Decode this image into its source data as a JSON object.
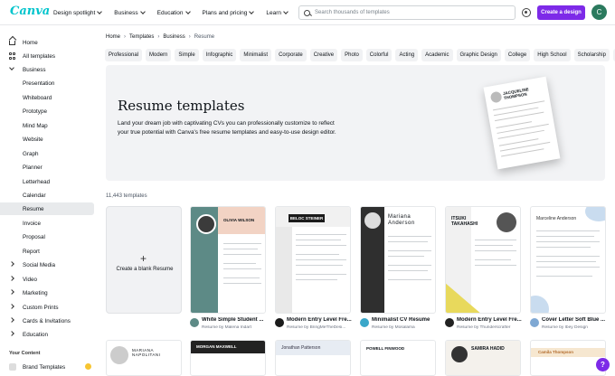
{
  "brand": {
    "logo": "Canva",
    "accent": "#7d2ae8",
    "logo_color": "#00c4cc"
  },
  "topnav": [
    {
      "label": "Design spotlight"
    },
    {
      "label": "Business"
    },
    {
      "label": "Education"
    },
    {
      "label": "Plans and pricing"
    },
    {
      "label": "Learn"
    }
  ],
  "search": {
    "placeholder": "Search thousands of templates"
  },
  "header": {
    "create_label": "Create a design",
    "avatar_initial": "C"
  },
  "sidebar": {
    "items": [
      {
        "label": "Home",
        "icon": "home-icon"
      },
      {
        "label": "All templates",
        "icon": "grid-icon"
      },
      {
        "label": "Business",
        "icon": "chevron-down-icon"
      },
      {
        "label": "Presentation"
      },
      {
        "label": "Whiteboard"
      },
      {
        "label": "Prototype"
      },
      {
        "label": "Mind Map"
      },
      {
        "label": "Website"
      },
      {
        "label": "Graph"
      },
      {
        "label": "Planner"
      },
      {
        "label": "Letterhead"
      },
      {
        "label": "Calendar"
      },
      {
        "label": "Resume"
      },
      {
        "label": "Invoice"
      },
      {
        "label": "Proposal"
      },
      {
        "label": "Report"
      },
      {
        "label": "Social Media",
        "icon": "chevron-right-icon"
      },
      {
        "label": "Video",
        "icon": "chevron-right-icon"
      },
      {
        "label": "Marketing",
        "icon": "chevron-right-icon"
      },
      {
        "label": "Custom Prints",
        "icon": "chevron-right-icon"
      },
      {
        "label": "Cards & Invitations",
        "icon": "chevron-right-icon"
      },
      {
        "label": "Education",
        "icon": "chevron-right-icon"
      }
    ],
    "section_title": "Your Content",
    "bottom_item": "Brand Templates"
  },
  "breadcrumb": [
    "Home",
    "Templates",
    "Business",
    "Resume"
  ],
  "chips": [
    "Professional",
    "Modern",
    "Simple",
    "Infographic",
    "Minimalist",
    "Corporate",
    "Creative",
    "Photo",
    "Colorful",
    "Acting",
    "Academic",
    "Graphic Design",
    "College",
    "High School",
    "Scholarship",
    "SE"
  ],
  "hero": {
    "title": "Resume templates",
    "desc": "Land your dream job with captivating CVs you can professionally customize to reflect your true potential with Canva's free resume templates and easy-to-use design editor.",
    "preview_name": "JACQUELINE THOMPSON"
  },
  "count": "11,443 templates",
  "blank_card": "Create a blank Resume",
  "templates": [
    {
      "title": "White Simple Student ...",
      "by": "Resume by Malena Indart",
      "name": "OLIVIA WILSON"
    },
    {
      "title": "Modern Entry Level Fre...",
      "by": "Resume by BringMeTheDesi...",
      "name": "BELOC STEINER"
    },
    {
      "title": "Minimalist CV Resume",
      "by": "Resume by Mosalama",
      "name": "Mariana Anderson"
    },
    {
      "title": "Modern Entry Level Fre...",
      "by": "Resume by Thunderscrafter",
      "name": "ITSUKI TAKAHASHI"
    },
    {
      "title": "Cover Letter Soft Blue ...",
      "by": "Resume by Ibey Design",
      "name": "Marceline Anderson"
    }
  ],
  "row2": [
    "MARIANA NAPOLITANI",
    "MORGAN MAXWELL",
    "Jonathan Patterson",
    "POWELL FINWOOD",
    "SAMIRA HADID",
    "Camila Thompson"
  ],
  "help": "?"
}
